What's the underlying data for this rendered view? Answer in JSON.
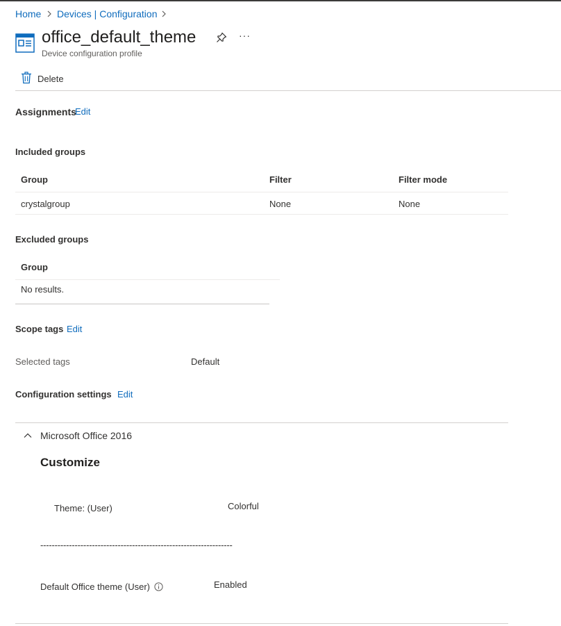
{
  "breadcrumb": {
    "home": "Home",
    "devices": "Devices | Configuration",
    "sep": ">"
  },
  "header": {
    "title": "office_default_theme",
    "subtitle": "Device configuration profile",
    "more_label": "···"
  },
  "toolbar": {
    "delete_label": "Delete"
  },
  "assignments": {
    "heading": "Assignments",
    "edit_label": "Edit",
    "included": {
      "heading": "Included groups",
      "columns": [
        "Group",
        "Filter",
        "Filter mode"
      ],
      "rows": [
        [
          "crystalgroup",
          "None",
          "None"
        ]
      ]
    },
    "excluded": {
      "heading": "Excluded groups",
      "columns": [
        "Group"
      ],
      "empty_text": "No results."
    }
  },
  "scope_tags": {
    "heading": "Scope tags",
    "edit_label": "Edit",
    "label": "Selected tags",
    "value": "Default"
  },
  "config_settings": {
    "heading": "Configuration settings",
    "edit_label": "Edit",
    "category": "Microsoft Office 2016",
    "subcategory": "Customize",
    "theme_label": "Theme: (User)",
    "theme_value": "Colorful",
    "divider": "-------------------------------------------------------------------",
    "default_theme_label": "Default Office theme (User)",
    "default_theme_value": "Enabled"
  },
  "colors": {
    "accent": "#0f6cbd",
    "text": "#323130",
    "muted": "#605e5c",
    "divider": "#edebe9"
  }
}
